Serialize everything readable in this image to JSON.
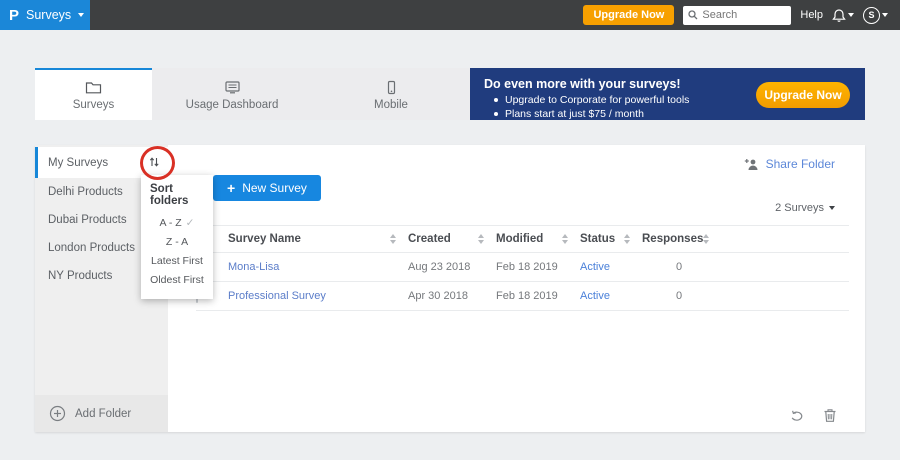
{
  "colors": {
    "brand_blue": "#1b87d8",
    "topbar_gray": "#3e4041",
    "banner_navy": "#203c7e",
    "orange_cta": "#f7a000",
    "button_blue": "#1787e0",
    "link_blue": "#5b7dc9",
    "status_blue": "#4a80d9",
    "annotation_red": "#d93025"
  },
  "topbar": {
    "logo": "P",
    "product": "Surveys",
    "upgrade_label": "Upgrade Now",
    "search_placeholder": "Search",
    "help_label": "Help",
    "avatar_initial": "S"
  },
  "tabs": [
    {
      "label": "Surveys"
    },
    {
      "label": "Usage Dashboard"
    },
    {
      "label": "Mobile"
    }
  ],
  "banner": {
    "title": "Do even more with your surveys!",
    "bullets": [
      "Upgrade to Corporate for powerful tools",
      "Plans start at just $75 / month"
    ],
    "cta_label": "Upgrade Now"
  },
  "sidebar": {
    "folders": [
      {
        "label": "My Surveys"
      },
      {
        "label": "Delhi Products"
      },
      {
        "label": "Dubai Products"
      },
      {
        "label": "London Products"
      },
      {
        "label": "NY Products"
      }
    ],
    "add_folder_label": "Add Folder"
  },
  "sort_menu": {
    "title": "Sort folders",
    "check_glyph": "✓",
    "options": [
      {
        "label": "A - Z",
        "selected": true
      },
      {
        "label": "Z - A",
        "selected": false
      },
      {
        "label": "Latest First",
        "selected": false
      },
      {
        "label": "Oldest First",
        "selected": false
      }
    ]
  },
  "content": {
    "share_folder_label": "Share Folder",
    "new_survey_plus": "+",
    "new_survey_label": "New Survey",
    "survey_count_label": "2 Surveys",
    "table": {
      "columns": [
        "Survey Name",
        "Created",
        "Modified",
        "Status",
        "Responses"
      ],
      "rows": [
        {
          "name": "Mona-Lisa",
          "created": "Aug 23 2018",
          "modified": "Feb 18 2019",
          "status": "Active",
          "responses": "0"
        },
        {
          "name": "Professional Survey",
          "created": "Apr 30 2018",
          "modified": "Feb 18 2019",
          "status": "Active",
          "responses": "0"
        }
      ]
    }
  }
}
